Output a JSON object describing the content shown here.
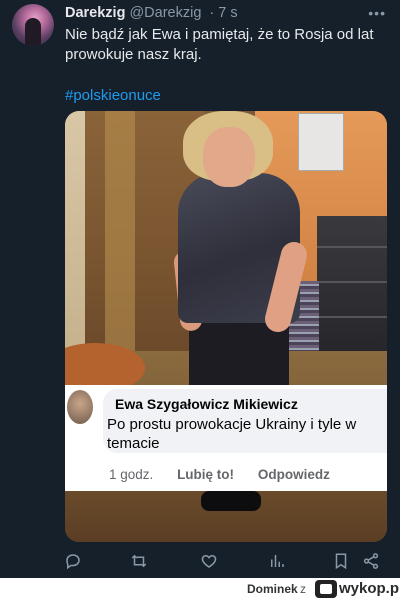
{
  "tweet": {
    "display_name": "Darekzig",
    "handle": "@Darekzig",
    "time": "· 7 s",
    "text": "Nie bądź jak Ewa i pamiętaj, że to Rosja od lat prowokuje nasz kraj.",
    "hashtag": "#polskieonuce"
  },
  "fb_comment": {
    "author": "Ewa Szygałowicz Mikiewicz",
    "text": "Po prostu prowokacje Ukrainy i tyle w temacie",
    "time": "1 godz.",
    "like_label": "Lubię to!",
    "reply_label": "Odpowiedz"
  },
  "actions": [
    "reply-icon",
    "retweet-icon",
    "like-icon",
    "views-icon",
    "bookmark-icon",
    "share-icon"
  ],
  "footer": {
    "username": "Dominek",
    "separator": "z",
    "brand": "wykop.pl"
  },
  "colors": {
    "background": "#15202b",
    "text": "#e7e9ea",
    "secondary": "#8b98a5",
    "link": "#1d9bf0"
  }
}
